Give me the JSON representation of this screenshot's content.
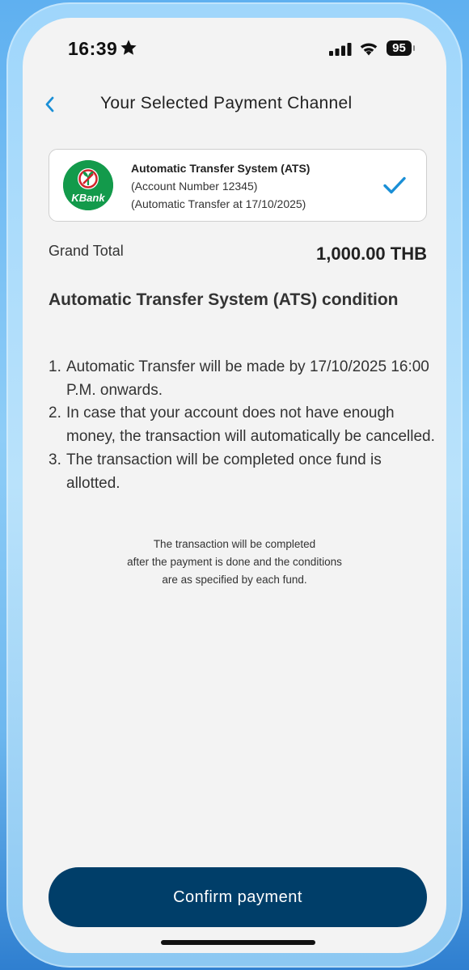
{
  "status_bar": {
    "time": "16:39",
    "battery": "95",
    "icons": [
      "star-icon",
      "signal-icon",
      "wifi-icon",
      "battery-icon"
    ]
  },
  "header": {
    "title": "Your Selected Payment Channel",
    "back_icon": "chevron-left-icon"
  },
  "payment_channel": {
    "bank_logo_text": "KBank",
    "name": "Automatic Transfer System (ATS)",
    "account": "(Account Number 12345)",
    "schedule": "(Automatic Transfer at 17/10/2025)",
    "selected": true,
    "check_icon": "checkmark-icon"
  },
  "grand_total": {
    "label": "Grand Total",
    "value": "1,000.00 THB"
  },
  "conditions": {
    "title": "Automatic Transfer System (ATS) condition",
    "items": [
      {
        "num": "1.",
        "text": "Automatic Transfer will be made by 17/10/2025 16:00 P.M. onwards."
      },
      {
        "num": "2.",
        "text": "In case that your account does not have enough money, the transaction will automatically be cancelled."
      },
      {
        "num": "3.",
        "text": "The transaction will be completed once fund is allotted."
      }
    ]
  },
  "note": {
    "line1": "The transaction will be completed",
    "line2": "after the payment is done and the conditions",
    "line3": "are as specified by each fund."
  },
  "confirm_button": {
    "label": "Confirm payment"
  },
  "colors": {
    "accent": "#1a8fd6",
    "button": "#003e69",
    "kbank_green": "#139a4b",
    "background": "#f3f3f3"
  }
}
